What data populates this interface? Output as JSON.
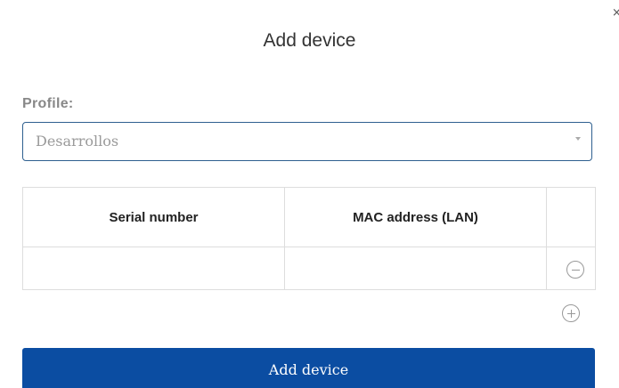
{
  "dialog": {
    "close_label": "×",
    "title": "Add device"
  },
  "profile": {
    "label": "Profile:",
    "selected_value": "Desarrollos"
  },
  "table": {
    "headers": [
      "Serial number",
      "MAC address (LAN)",
      ""
    ],
    "rows": [
      {
        "serial_number": "",
        "mac_address": ""
      }
    ]
  },
  "icons": {
    "remove_row": "minus-circle-icon",
    "add_row": "plus-circle-icon",
    "select_arrow": "chevron-down-icon",
    "close": "close-icon"
  },
  "colors": {
    "primary": "#0b4da2",
    "select_border": "#2e5f8f"
  },
  "submit": {
    "label": "Add device"
  }
}
